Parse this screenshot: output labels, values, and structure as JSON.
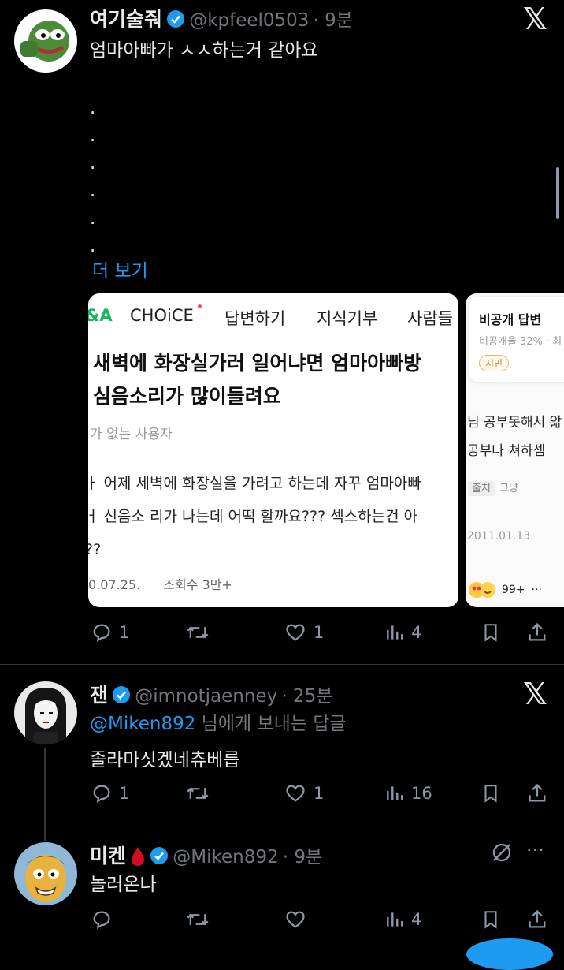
{
  "tweet1": {
    "name": "여기술줘",
    "handle": "@kpfeel0503",
    "time": "· 9분",
    "text": "엄마아빠가 ㅅㅅ하는거 같아요",
    "dots": [
      ".",
      ".",
      ".",
      ".",
      ".",
      "."
    ],
    "more_label": "더 보기",
    "actions": {
      "reply": "1",
      "retweet": "",
      "like": "1",
      "views": "4"
    }
  },
  "card1": {
    "nav": [
      "&A",
      "CHOiCE",
      "답변하기",
      "지식기부",
      "사람들"
    ],
    "title_line1": "새벽에 화장실가러 일어냐면 엄마아빠방",
    "title_line2": "심음소리가 많이들려요",
    "author": "가 없는 사용자",
    "body_line1": "ㅏ 어제 세벽에 화장실을 가려고 하는데 자꾸 엄마아빠",
    "body_line2": "ㅓ 신음소 리가 나는데 어떡 할까요??? 섹스하는건 아",
    "body_line3": "??",
    "date": "0.07.25.",
    "views": "조회수 3만+"
  },
  "card2": {
    "title": "비공개 답변",
    "rate": "비공개율 32% · 최",
    "badge": "시민",
    "line1": "님 공부못해서 앎",
    "line2": "공부나 쳐하셈",
    "source_label": "출처",
    "source_value": "그냥",
    "date": "2011.01.13.",
    "reactions": "99+"
  },
  "tweet2": {
    "name": "잰",
    "handle": "@imnotjaenney",
    "time": "· 25분",
    "reply_to_handle": "@Miken892",
    "reply_to_suffix": " 님에게 보내는 답글",
    "text": "졸라마싯겠네츄베릅",
    "actions": {
      "reply": "1",
      "retweet": "",
      "like": "1",
      "views": "16"
    }
  },
  "tweet3": {
    "name": "미켄",
    "handle": "@Miken892",
    "time": "· 9분",
    "text": "놀러온나",
    "actions": {
      "reply": "",
      "retweet": "",
      "like": "",
      "views": "4"
    }
  },
  "colors": {
    "background": "#000000",
    "link": "#1d9bf0",
    "verified": "#1d9bf0",
    "muted": "#71767b"
  }
}
